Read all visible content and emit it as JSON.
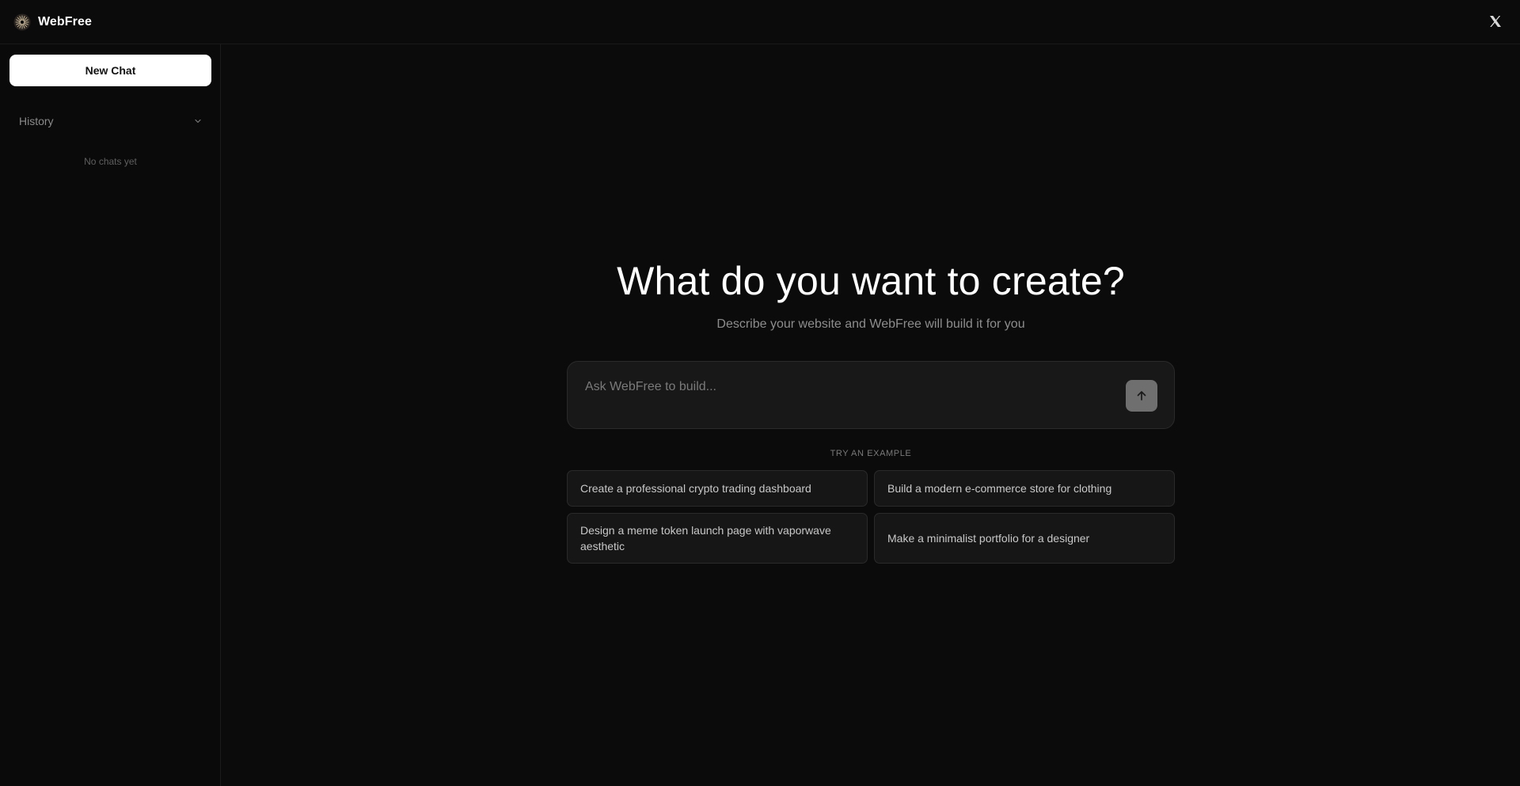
{
  "app": {
    "name": "WebFree",
    "logo_icon": "starburst-logo-icon",
    "social_icon": "x-logo-icon"
  },
  "sidebar": {
    "new_chat_label": "New Chat",
    "history_label": "History",
    "history_icon": "chevron-down-icon",
    "empty_text": "No chats yet"
  },
  "main": {
    "title": "What do you want to create?",
    "subtitle": "Describe your website and WebFree will build it for you",
    "prompt": {
      "value": "",
      "placeholder": "Ask WebFree to build...",
      "send_icon": "arrow-up-icon"
    },
    "examples_label": "TRY AN EXAMPLE",
    "examples": [
      {
        "label": "Create a professional crypto trading dashboard"
      },
      {
        "label": "Build a modern e-commerce store for clothing"
      },
      {
        "label": "Design a meme token launch page with vaporwave aesthetic"
      },
      {
        "label": "Make a minimalist portfolio for a designer"
      }
    ]
  },
  "colors": {
    "background": "#0b0b0b",
    "surface": "#181818",
    "border": "#2a2a2a",
    "primary_button": "#ffffff",
    "send_button": "#6f6f6f",
    "muted_text": "#8d8d8d"
  }
}
